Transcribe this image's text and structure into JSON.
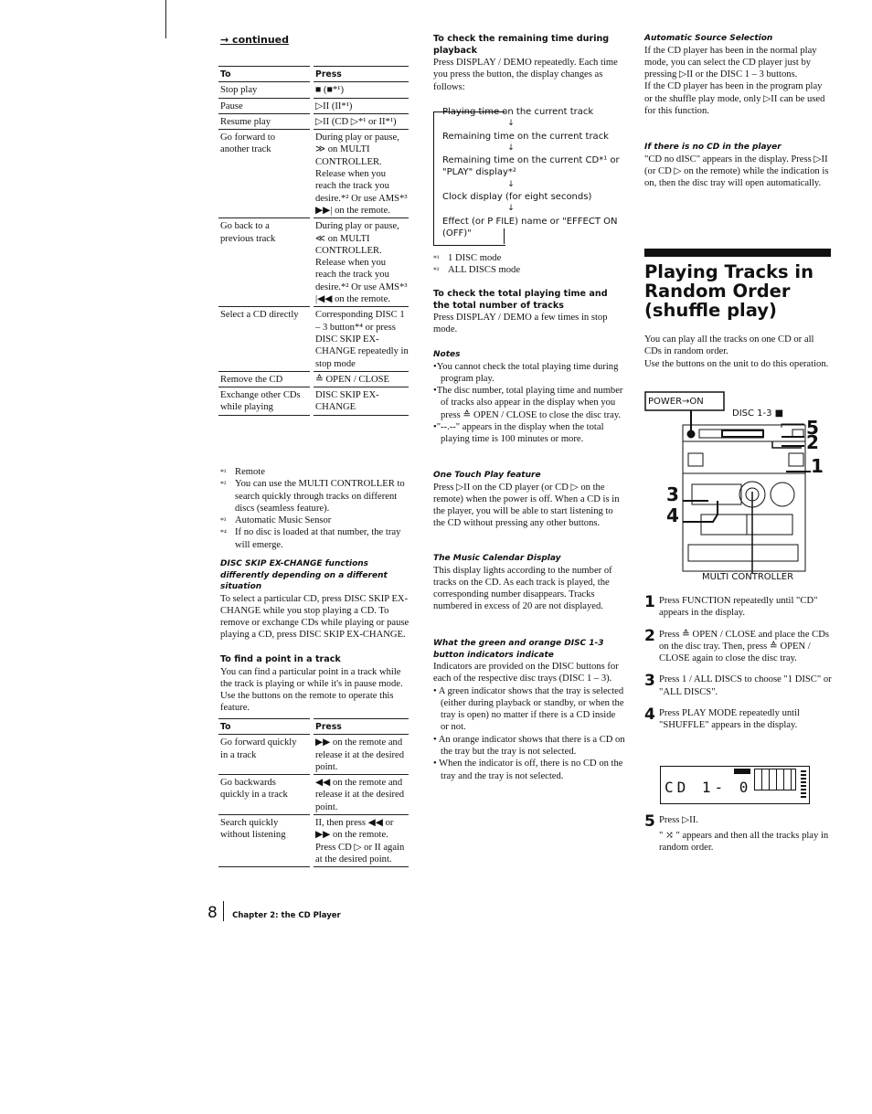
{
  "col1": {
    "continued": "→ continued",
    "table1": {
      "headers": [
        "To",
        "Press"
      ],
      "rows": [
        [
          "Stop play",
          "■ (■*¹)"
        ],
        [
          "Pause",
          "▷II (II*¹)"
        ],
        [
          "Resume play",
          "▷II (CD ▷*¹ or II*¹)"
        ],
        [
          "Go forward to another track",
          "During play or pause, ≫ on MULTI CONTROLLER. Release when you reach the track you desire.*² Or use AMS*³ ▶▶| on the remote."
        ],
        [
          "Go back to a previous track",
          "During play or pause, ≪ on MULTI CONTROLLER. Release when you reach the track you desire.*² Or use AMS*³ |◀◀ on the remote."
        ],
        [
          "Select a CD directly",
          "Corresponding DISC 1 – 3 button*⁴ or press DISC SKIP EX-CHANGE repeatedly in stop mode"
        ],
        [
          "Remove the CD",
          "≙ OPEN / CLOSE"
        ],
        [
          "Exchange other CDs while playing",
          "DISC SKIP EX-CHANGE"
        ]
      ]
    },
    "footnotes": [
      {
        "mark": "*¹",
        "text": "Remote"
      },
      {
        "mark": "*²",
        "text": "You can use the MULTI CONTROLLER to search quickly through tracks on different discs (seamless feature)."
      },
      {
        "mark": "*³",
        "text": "Automatic Music Sensor"
      },
      {
        "mark": "*⁴",
        "text": "If no disc is loaded at that number, the tray will emerge."
      }
    ],
    "discskip_heading": "DISC SKIP EX-CHANGE functions differently depending on a different situation",
    "discskip_text": "To select a particular CD, press DISC SKIP EX-CHANGE while you stop playing a CD. To remove or exchange CDs while playing or pause playing a CD, press DISC SKIP EX-CHANGE.",
    "findpoint_heading": "To find a point in a track",
    "findpoint_text": "You can find a particular point in a track while the track is playing or while it's in pause mode. Use the buttons on the remote to operate this feature.",
    "table2": {
      "headers": [
        "To",
        "Press"
      ],
      "rows": [
        [
          "Go forward quickly in a track",
          "▶▶ on the remote and release it at the desired point."
        ],
        [
          "Go backwards quickly in a track",
          "◀◀ on the remote and release it at the desired point."
        ],
        [
          "Search quickly without listening",
          "II, then press ◀◀ or ▶▶ on the remote. Press CD ▷ or II again at the desired point."
        ]
      ]
    }
  },
  "col2": {
    "remaining_heading": "To check the remaining time during playback",
    "remaining_text": "Press DISPLAY / DEMO repeatedly. Each time you press the button, the display changes as follows:",
    "flow": [
      "Playing time on the current track",
      "Remaining time on the current track",
      "Remaining time on the current CD*¹ or \"PLAY\" display*²",
      "Clock display (for eight seconds)",
      "Effect (or P FILE) name or \"EFFECT ON (OFF)\""
    ],
    "flow_arrow": "↓",
    "footnotes": [
      {
        "mark": "*¹",
        "text": "1 DISC mode"
      },
      {
        "mark": "*²",
        "text": "ALL DISCS mode"
      }
    ],
    "total_heading": "To check the total playing time and the total number of tracks",
    "total_text": "Press DISPLAY / DEMO a few times in stop mode.",
    "notes_heading": "Notes",
    "notes": [
      "•You cannot check the total playing time during program play.",
      "•The disc number, total playing time and number of tracks also appear in the display when you press ≙ OPEN / CLOSE to close the disc tray.",
      "•\"--.--\" appears in the display when the total playing time is 100 minutes or more."
    ],
    "onetouch_heading": "One Touch Play feature",
    "onetouch_text": "Press ▷II on the CD player (or CD ▷ on the remote) when the power is off. When a CD is in the player, you will be able to start listening to the CD without pressing any other buttons.",
    "calendar_heading": "The Music Calendar Display",
    "calendar_text": "This display lights according to the number of tracks on the CD. As each track is played, the corresponding number disappears. Tracks numbered in excess of 20 are not displayed.",
    "indicator_heading": "What the green and orange DISC 1-3 button indicators indicate",
    "indicator_text": "Indicators are provided on the DISC buttons for each of the respective disc trays (DISC 1 – 3).",
    "indicator_bullets": [
      "• A green indicator shows that the tray is selected (either during playback or standby, or when the tray is open) no matter if there is a CD inside or not.",
      "• An orange indicator shows that there is a CD on the tray but the tray is not selected.",
      "• When the indicator is off, there is no CD on the tray and the tray is not selected."
    ]
  },
  "col3": {
    "auto_heading": "Automatic Source Selection",
    "auto_text1": "If the CD player has been in the normal play mode, you can select the CD player just by pressing ▷II or the DISC 1 – 3 buttons.",
    "auto_text2": "If the CD player has been in the program play or the shuffle play mode, only ▷II can be used for this function.",
    "nocd_heading": "If there is no CD in the player",
    "nocd_text": "\"CD no dISC\" appears in the display. Press ▷II (or CD ▷ on the remote) while the indication is on, then the disc tray will open automatically.",
    "section_title": "Playing Tracks in Random Order (shuffle play)",
    "intro1": "You can play all the tracks on one CD or all CDs in random order.",
    "intro2": "Use the buttons on the unit to do this operation.",
    "diagram": {
      "power_label": "POWER→ON",
      "disc_label": "DISC 1-3 ■",
      "multi_label": "MULTI CONTROLLER",
      "callouts": [
        "1",
        "2",
        "3",
        "4",
        "5"
      ]
    },
    "steps": [
      {
        "n": "1",
        "text": "Press FUNCTION repeatedly until \"CD\" appears in the display."
      },
      {
        "n": "2",
        "text": "Press ≙ OPEN / CLOSE and place the CDs on the disc tray. Then, press ≙ OPEN / CLOSE again to close the disc tray."
      },
      {
        "n": "3",
        "text": "Press 1 / ALL DISCS to choose \"1 DISC\" or \"ALL DISCS\"."
      },
      {
        "n": "4",
        "text": "Press PLAY MODE repeatedly until \"SHUFFLE\" appears in the display."
      }
    ],
    "lcd_text": "CD 1-  0",
    "step5": {
      "n": "5",
      "title": "Press ▷II.",
      "text": "\" ⤮ \" appears and then all the tracks play in random order."
    }
  },
  "footer": {
    "page": "8",
    "chapter": "Chapter 2: the CD Player"
  }
}
